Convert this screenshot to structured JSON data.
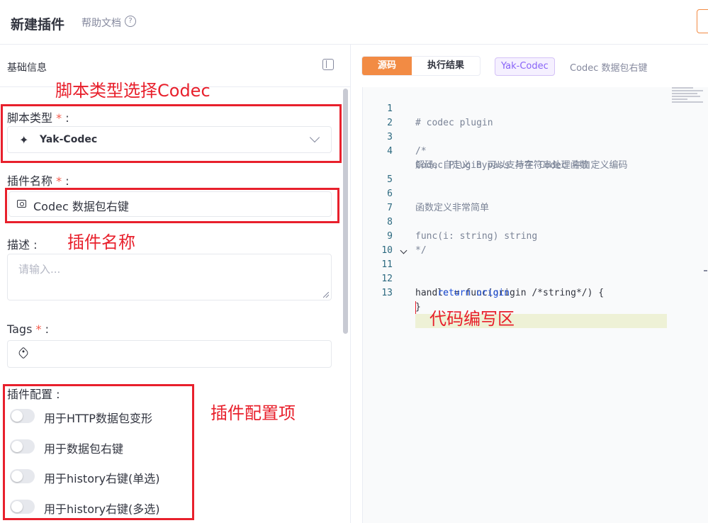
{
  "header": {
    "title": "新建插件",
    "help_text": "帮助文档",
    "help_icon": "question-circle-icon"
  },
  "left_panel": {
    "section_title": "基础信息",
    "script_type": {
      "label": "脚本类型",
      "required_mark": "*",
      "colon": ":",
      "value": "Yak-Codec",
      "icon": "sparkles-icon"
    },
    "plugin_name": {
      "label": "插件名称",
      "required_mark": "*",
      "colon": ":",
      "value": "Codec 数据包右键",
      "icon": "plugin-card-icon"
    },
    "description": {
      "label": "描述",
      "colon": ":",
      "placeholder": "请输入..."
    },
    "tags": {
      "label": "Tags",
      "required_mark": "*",
      "colon": ":",
      "icon": "tag-icon"
    },
    "plugin_config": {
      "label": "插件配置",
      "colon": ":",
      "options": [
        {
          "label": "用于HTTP数据包变形",
          "enabled": false
        },
        {
          "label": "用于数据包右键",
          "enabled": false
        },
        {
          "label": "用于history右键(单选)",
          "enabled": false
        },
        {
          "label": "用于history右键(多选)",
          "enabled": false
        }
      ]
    }
  },
  "right_panel": {
    "tabs": [
      {
        "label": "源码",
        "active": true
      },
      {
        "label": "执行结果",
        "active": false
      }
    ],
    "type_badge": "Yak-Codec",
    "plugin_name": "Codec 数据包右键",
    "code_lines": [
      "# codec plugin",
      "",
      "/*",
      "Codec Plugin 可以支持在 Codec 中自定义编码",
      "解码，自定义 Bypass 与字符串处理函数",
      "",
      "函数定义非常简单",
      "",
      "func(i: string) string",
      "*/",
      "",
      "handle = func(origin /*string*/) {",
      "    return origin",
      "}"
    ],
    "line_numbers": [
      "1",
      "2",
      "3",
      "4",
      "5",
      "6",
      "7",
      "8",
      "9",
      "10",
      "11",
      "12",
      "13"
    ]
  },
  "annotations": {
    "script_type_note": "脚本类型选择Codec",
    "plugin_name_note": "插件名称",
    "plugin_config_note": "插件配置项",
    "code_area_note": "代码编写区"
  },
  "colors": {
    "accent": "#f28b44",
    "annotation": "#e8202c",
    "badge": "#8863f7"
  }
}
